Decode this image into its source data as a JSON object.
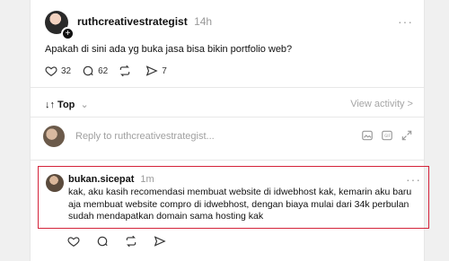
{
  "post": {
    "username": "ruthcreativestrategist",
    "time": "14h",
    "more": "···",
    "text": "Apakah di sini ada yg buka jasa bisa bikin portfolio web?",
    "likes": "32",
    "replies": "62"
  },
  "sort": {
    "label": "↓↑ Top",
    "chevron": "⌄",
    "view_activity": "View activity >"
  },
  "reply_box": {
    "placeholder": "Reply to ruthcreativestrategist..."
  },
  "comment": {
    "username": "bukan.sicepat",
    "time": "1m",
    "more": "···",
    "text": "kak, aku kasih recomendasi membuat website di idwebhost kak, kemarin aku baru aja membuat website compro di idwebhost, dengan biaya mulai dari 34k perbulan sudah mendapatkan domain sama hosting kak"
  },
  "colors": {
    "highlight_border": "#d4233a",
    "muted": "#9a9a9a"
  },
  "icons": [
    "heart-icon",
    "comment-icon",
    "repost-icon",
    "share-icon",
    "image-icon",
    "gif-icon",
    "expand-icon"
  ]
}
